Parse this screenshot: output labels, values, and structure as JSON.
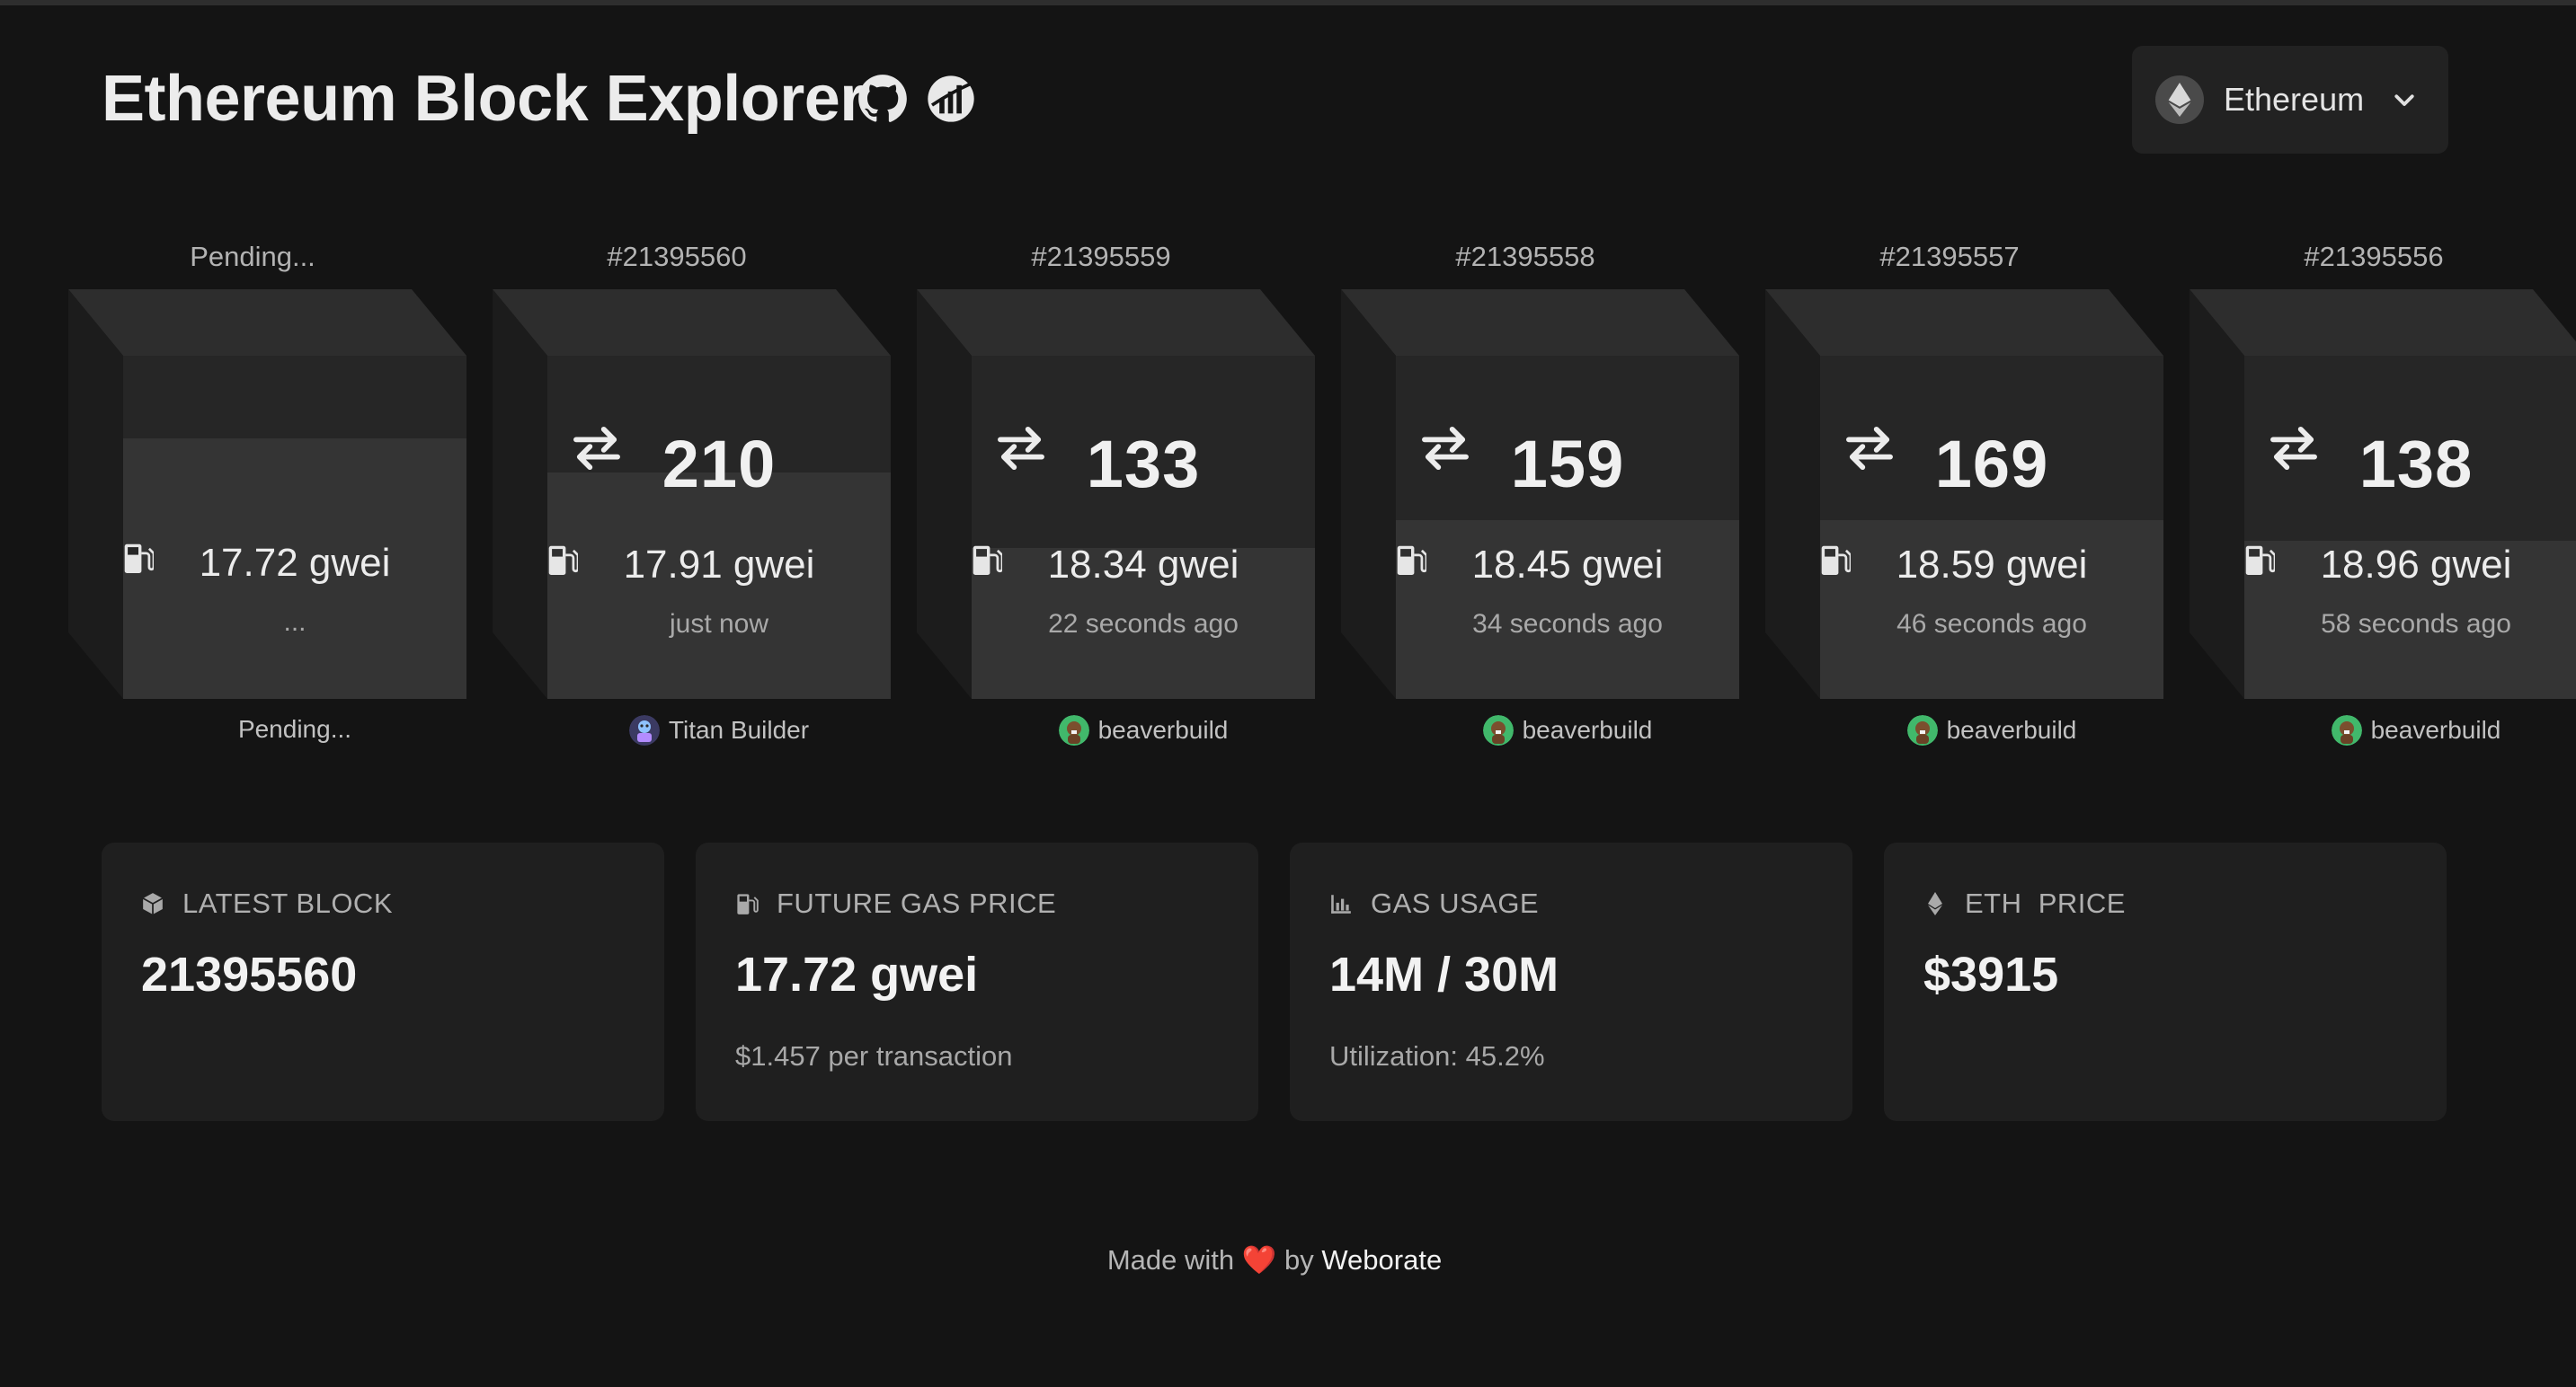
{
  "header": {
    "title": "Ethereum Block Explorer",
    "icons": [
      "github-icon",
      "ultrasound-icon"
    ]
  },
  "network": {
    "label": "Ethereum",
    "icon": "ethereum-icon"
  },
  "blocks": [
    {
      "number": "Pending...",
      "tx_count": "",
      "gas": "17.72 gwei",
      "time": "...",
      "builder": "Pending...",
      "fill": 0.76
    },
    {
      "number": "#21395560",
      "tx_count": "210",
      "gas": "17.91 gwei",
      "time": "just now",
      "builder": "Titan Builder",
      "fill": 0.66
    },
    {
      "number": "#21395559",
      "tx_count": "133",
      "gas": "18.34 gwei",
      "time": "22 seconds ago",
      "builder": "beaverbuild",
      "fill": 0.44
    },
    {
      "number": "#21395558",
      "tx_count": "159",
      "gas": "18.45 gwei",
      "time": "34 seconds ago",
      "builder": "beaverbuild",
      "fill": 0.52
    },
    {
      "number": "#21395557",
      "tx_count": "169",
      "gas": "18.59 gwei",
      "time": "46 seconds ago",
      "builder": "beaverbuild",
      "fill": 0.52
    },
    {
      "number": "#21395556",
      "tx_count": "138",
      "gas": "18.96 gwei",
      "time": "58 seconds ago",
      "builder": "beaverbuild",
      "fill": 0.46
    }
  ],
  "stats": {
    "latest_block": {
      "label": "LATEST BLOCK",
      "value": "21395560"
    },
    "future_gas": {
      "label": "FUTURE GAS PRICE",
      "value": "17.72 gwei",
      "sub": "$1.457 per transaction"
    },
    "gas_usage": {
      "label": "GAS USAGE",
      "value": "14M / 30M",
      "sub": "Utilization: 45.2%"
    },
    "eth_price": {
      "label": "ETH  PRICE",
      "value": "$3915"
    }
  },
  "footer": {
    "prefix": "Made with",
    "heart": "❤️",
    "by": "by",
    "link": "Weborate"
  },
  "colors": {
    "background": "#141414",
    "card": "#1f1f1f",
    "cube_front": "#262626",
    "cube_fill": "#343434"
  }
}
